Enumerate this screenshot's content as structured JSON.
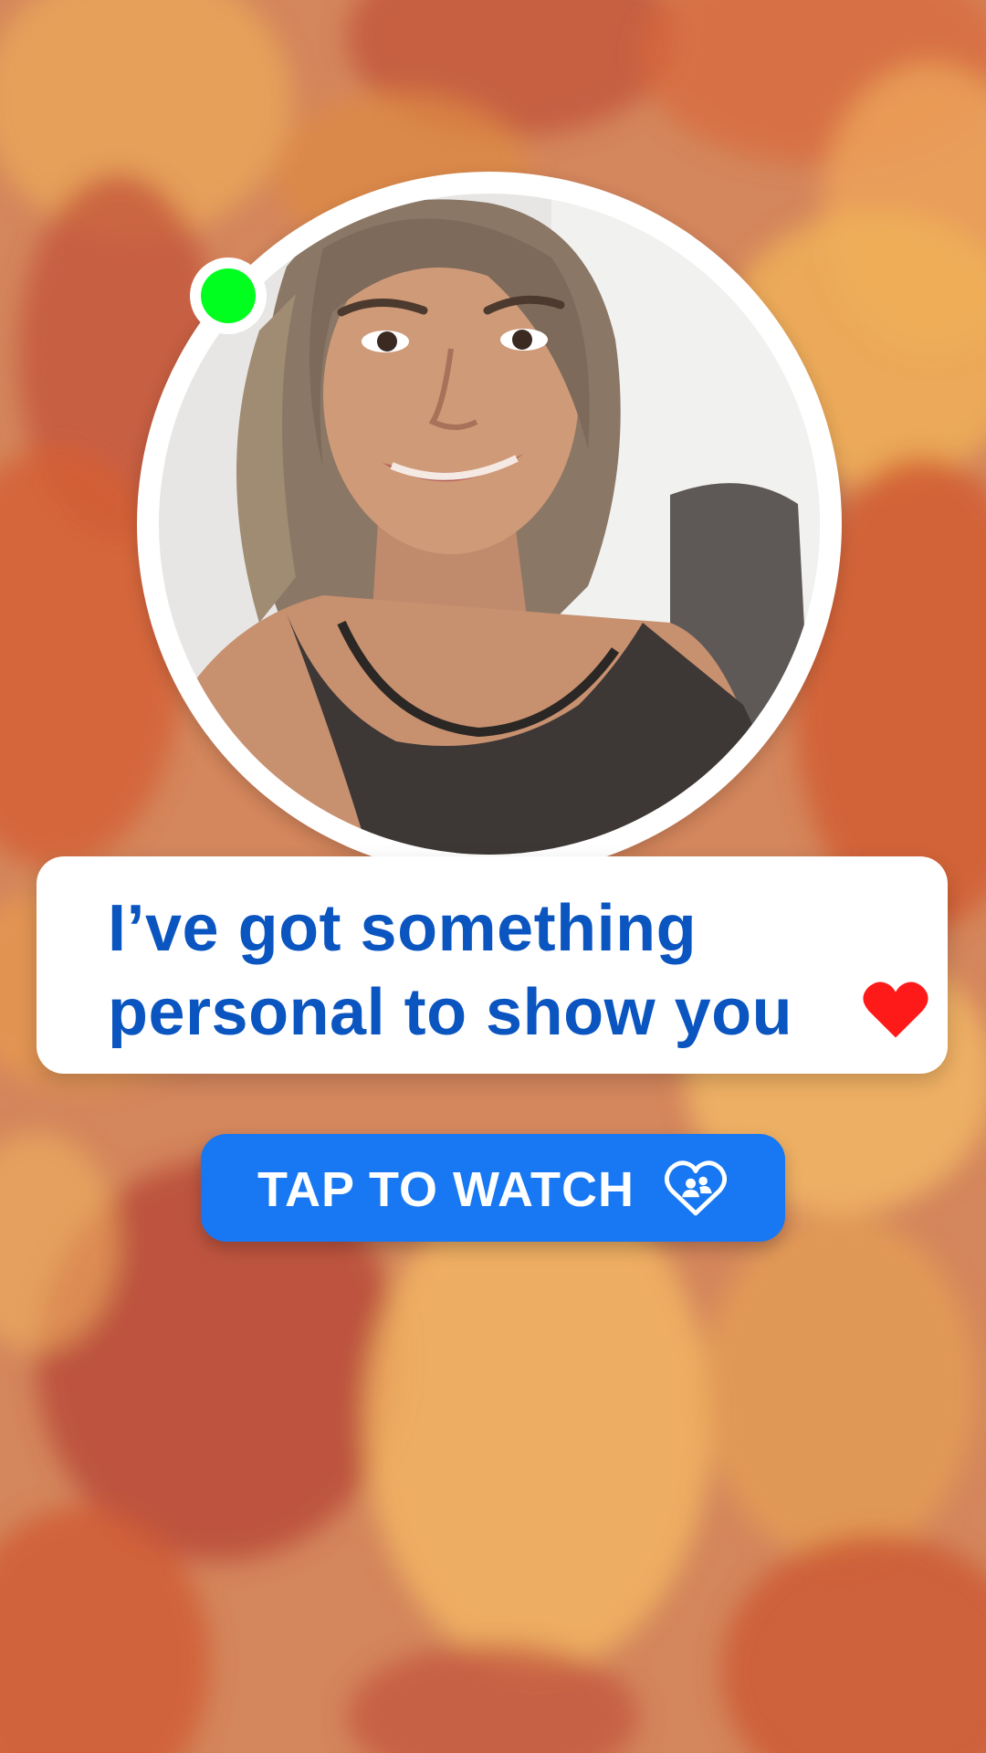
{
  "message": {
    "line1": "I’ve got something",
    "line2": "personal to show you"
  },
  "cta": {
    "label": "TAP TO WATCH"
  },
  "icons": {
    "message_heart": "heart-icon",
    "cta_icon": "heart-with-people-icon",
    "status": "online-status-dot"
  },
  "colors": {
    "text_blue": "#0a55c0",
    "button_blue": "#1877f2",
    "online_green": "#00ff1e",
    "heart_red": "#ff1a1a",
    "background": "#d4865c"
  }
}
